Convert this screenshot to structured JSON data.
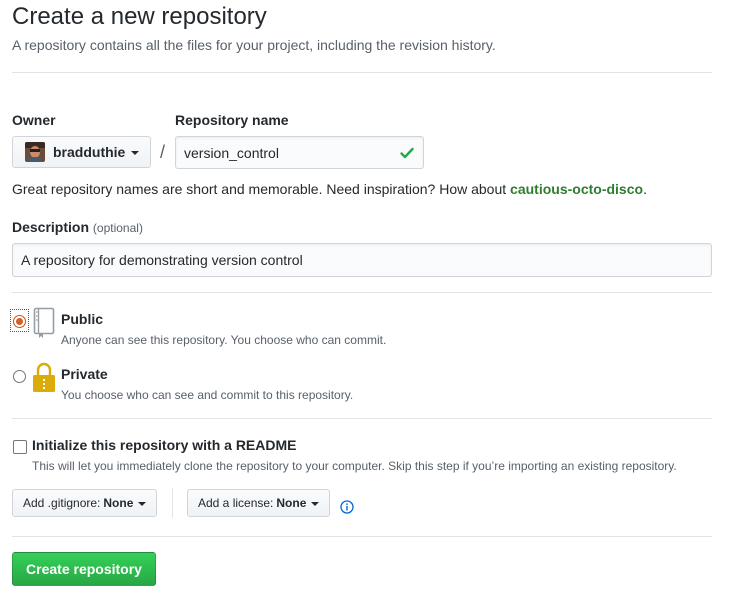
{
  "header": {
    "title": "Create a new repository",
    "subtitle": "A repository contains all the files for your project, including the revision history."
  },
  "owner": {
    "label": "Owner",
    "name": "bradduthie",
    "avatar_icon": "user-avatar"
  },
  "separator": "/",
  "repository": {
    "label": "Repository name",
    "value": "version_control",
    "status_icon": "check-icon"
  },
  "hint": {
    "text": "Great repository names are short and memorable. Need inspiration? How about ",
    "suggestion": "cautious-octo-disco",
    "suffix": "."
  },
  "description": {
    "label": "Description",
    "optional": "(optional)",
    "value": "A repository for demonstrating version control"
  },
  "visibility": {
    "public": {
      "title": "Public",
      "note": "Anyone can see this repository. You choose who can commit.",
      "icon": "repo-book-icon",
      "selected": true
    },
    "private": {
      "title": "Private",
      "note": "You choose who can see and commit to this repository.",
      "icon": "lock-icon",
      "selected": false
    }
  },
  "readme": {
    "label": "Initialize this repository with a README",
    "note": "This will let you immediately clone the repository to your computer. Skip this step if you’re importing an existing repository.",
    "checked": false
  },
  "gitignore": {
    "prefix": "Add .gitignore:",
    "value": "None"
  },
  "license": {
    "prefix": "Add a license:",
    "value": "None"
  },
  "submit": {
    "label": "Create repository"
  },
  "colors": {
    "accent_green": "#28a745",
    "suggestion_green": "#2e7d32",
    "radio_selected": "#d35f2a",
    "info_blue": "#0366d6"
  }
}
